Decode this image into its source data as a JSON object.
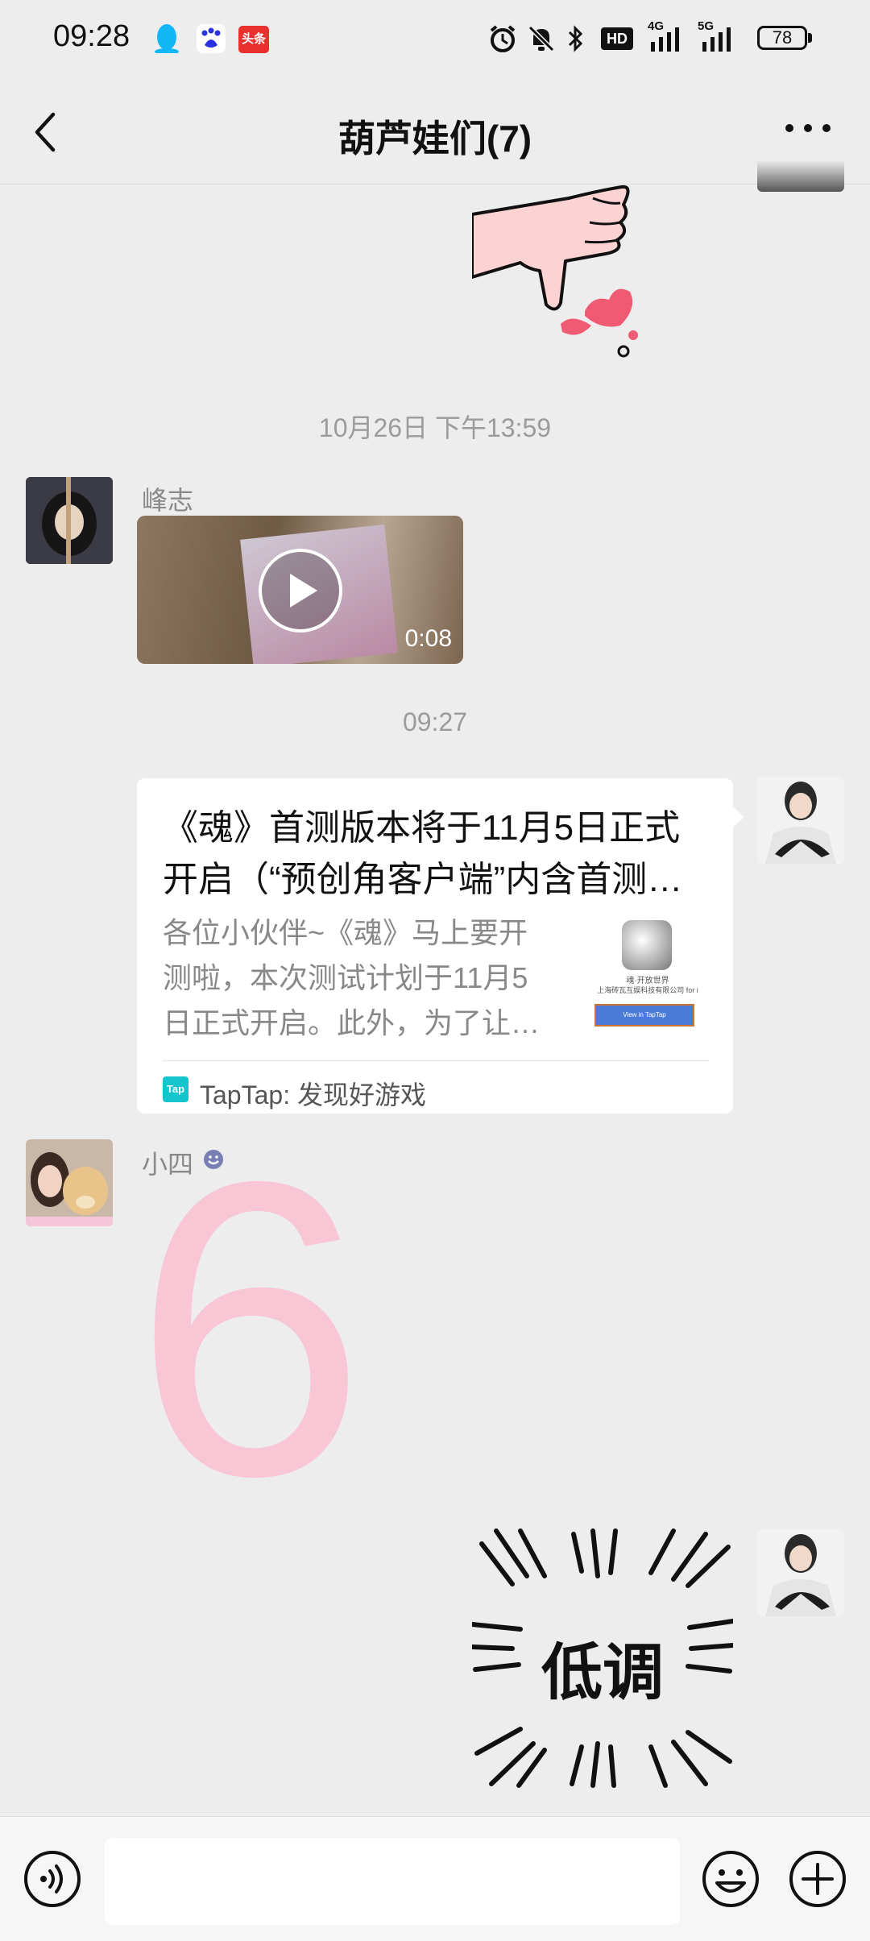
{
  "status_bar": {
    "time": "09:28",
    "hd_label": "HD",
    "network_1": "4G",
    "network_2": "5G",
    "battery": "78",
    "app_badge": "头条"
  },
  "header": {
    "title": "葫芦娃们(7)"
  },
  "messages": {
    "ts1": "10月26日 下午13:59",
    "sender1": "峰志",
    "video_duration": "0:08",
    "ts2": "09:27",
    "link_title": "《魂》首测版本将于11月5日正式开启（“预创角客户端”内含首测…",
    "link_title_line1": "《魂》首测版本将于11月5日正式",
    "link_title_line2": "开启（“预创角客户端”内含首测…",
    "link_desc_line1": "各位小伙伴~《魂》马上要开",
    "link_desc_line2": "测啦，本次测试计划于11月5",
    "link_desc_line3": "日正式开启。此外，为了让…",
    "thumb_text1": "魂·开放世界",
    "thumb_text2": "上海砖瓦互娱科技有限公司 for i",
    "thumb_button": "View in TapTap",
    "source_icon_text": "Tap",
    "source_name": "TapTap: 发现好游戏",
    "sender2": "小四",
    "big_sticker": "6",
    "sticker_text": "低调"
  },
  "colors": {
    "background": "#ededed",
    "sticker_pink": "#f9c6d6",
    "taptap": "#15c5ce"
  },
  "icons": [
    "back-icon",
    "more-icon",
    "play-icon",
    "voice-icon",
    "emoji-icon",
    "plus-icon"
  ]
}
